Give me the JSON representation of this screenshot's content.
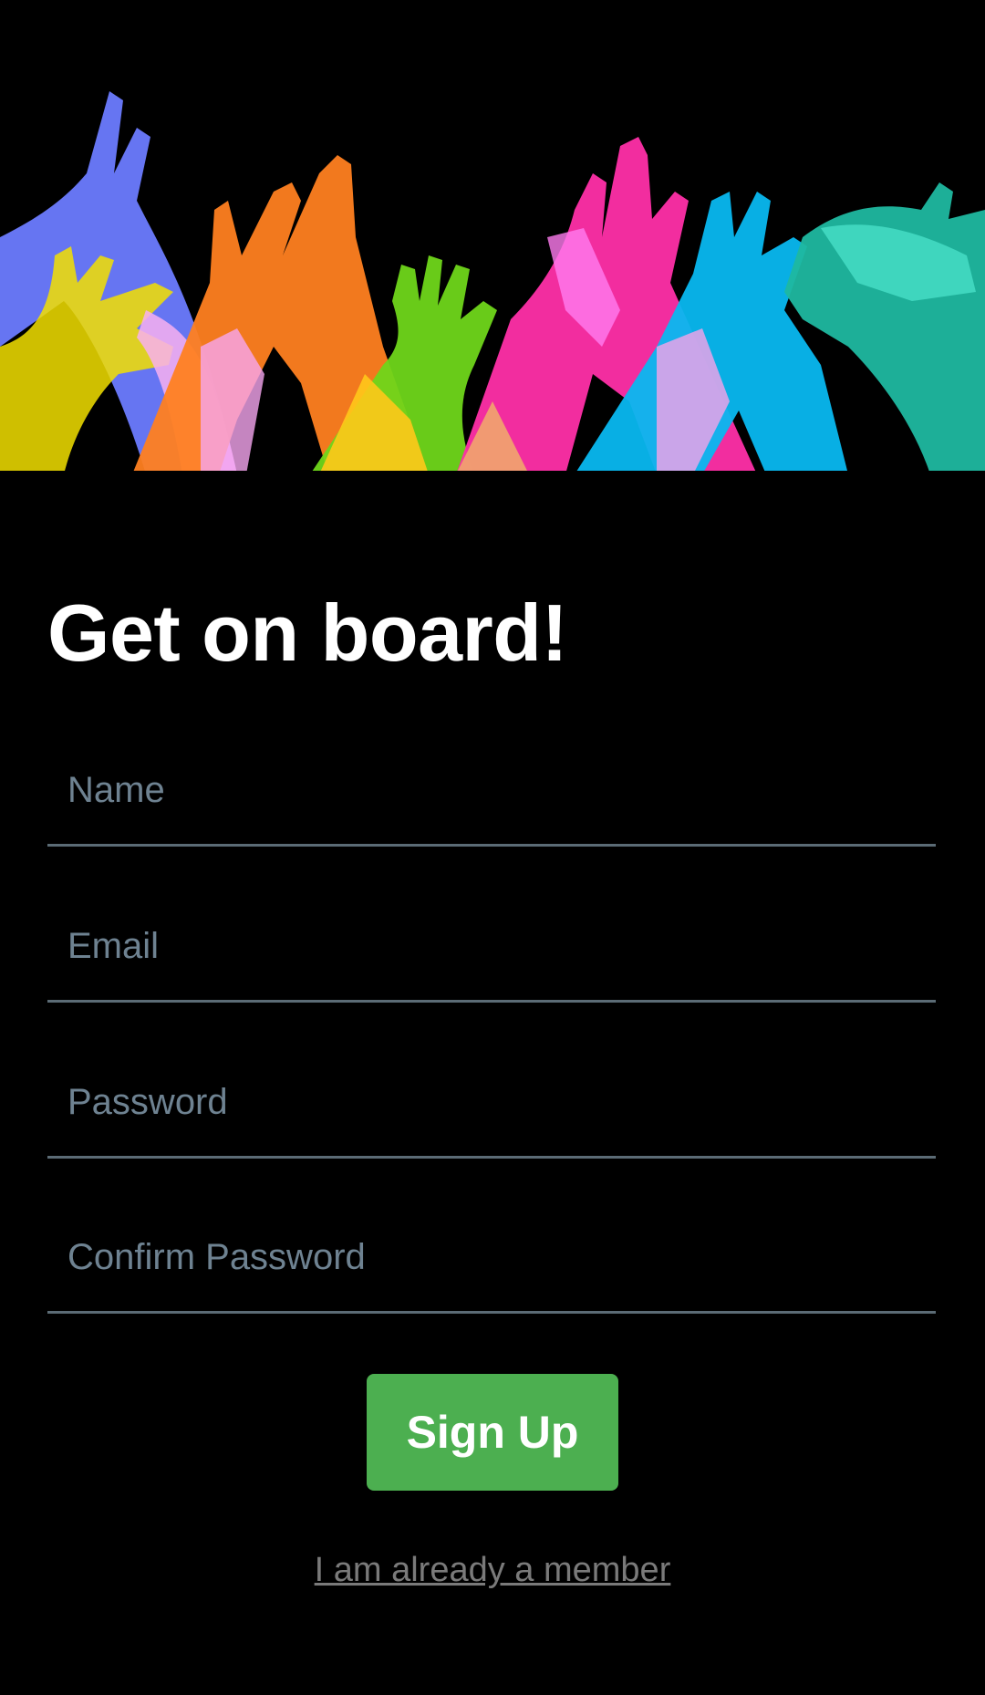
{
  "hero": {
    "image": "raised-hands-illustration",
    "colors": [
      "#6b7bff",
      "#f3e000",
      "#ff8020",
      "#f8a8f0",
      "#6fd61a",
      "#ff2fa8",
      "#08b8f0",
      "#1fb8a0"
    ]
  },
  "title": "Get on board!",
  "form": {
    "name_placeholder": "Name",
    "email_placeholder": "Email",
    "password_placeholder": "Password",
    "confirm_password_placeholder": "Confirm Password",
    "signup_label": "Sign Up",
    "member_link": "I am already a member"
  },
  "colors": {
    "background": "#000000",
    "accent": "#4caf50",
    "placeholder": "#6e8291",
    "underline": "#5b6b75",
    "link": "#7a7a7a"
  }
}
